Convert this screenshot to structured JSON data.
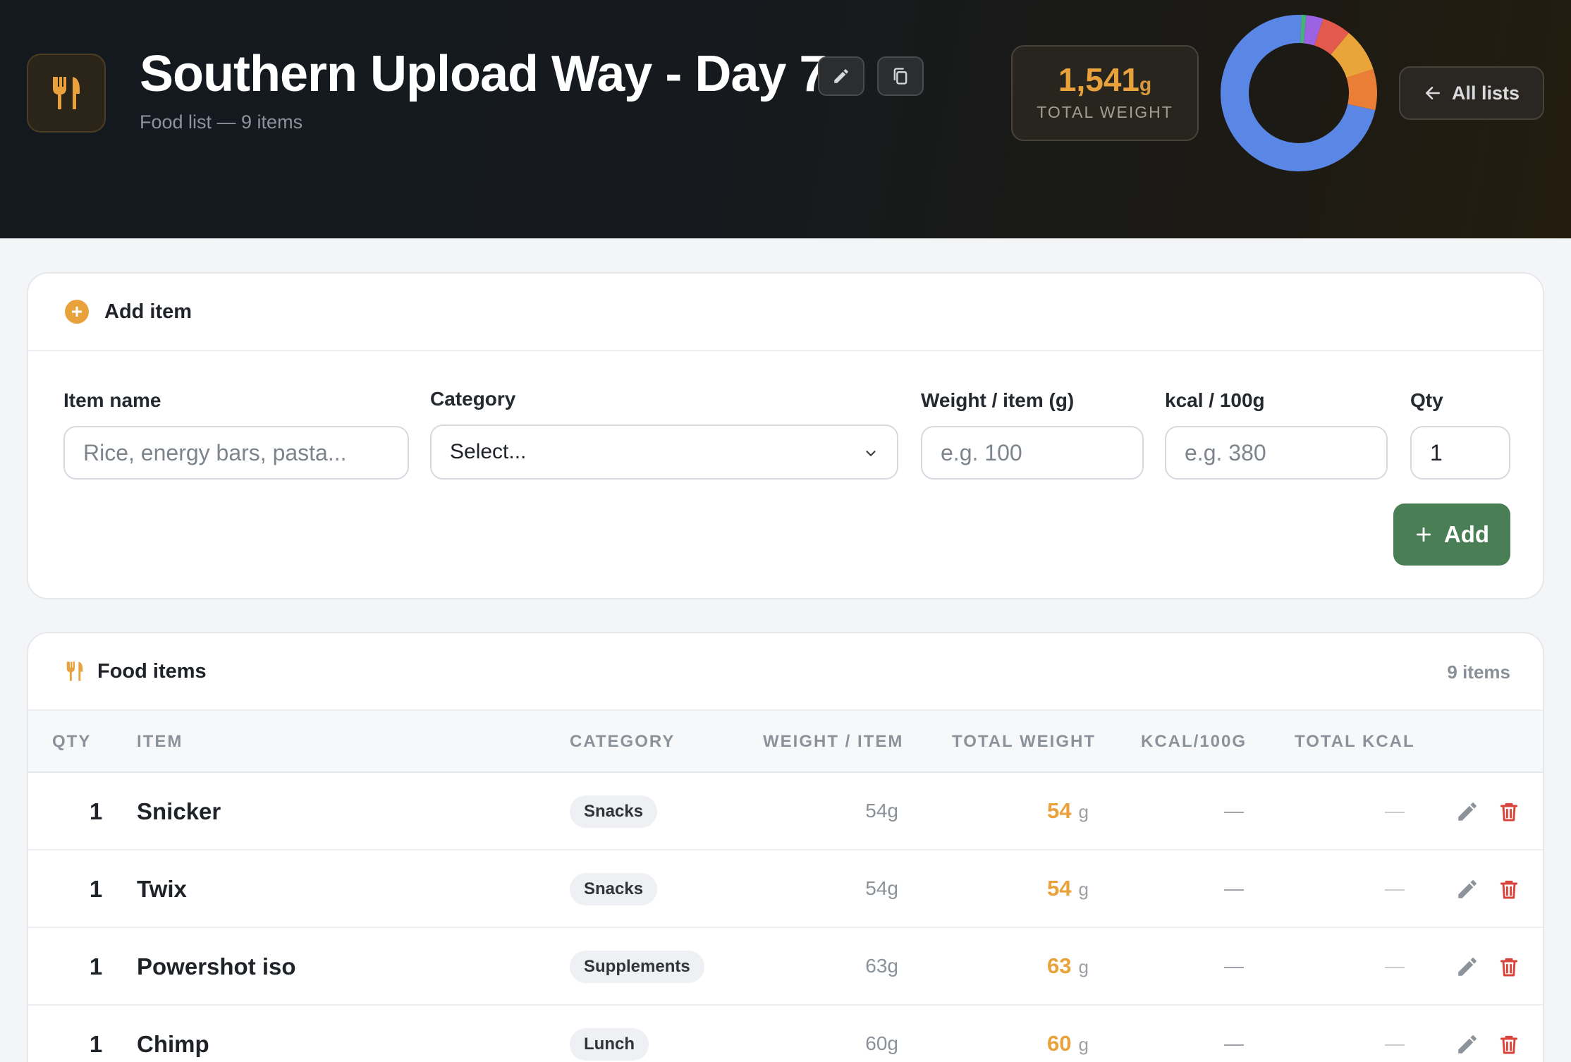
{
  "header": {
    "title": "Southern Upload Way - Day 7",
    "subtitle": "Food list — 9 items",
    "total_weight_value": "1,541",
    "total_weight_unit": "g",
    "total_weight_label": "TOTAL WEIGHT",
    "all_lists_label": "All lists",
    "donut_segments": [
      {
        "fraction": 0.72,
        "color": "#5a86e6"
      },
      {
        "fraction": 0.01,
        "color": "#46b37a"
      },
      {
        "fraction": 0.035,
        "color": "#9b63e2"
      },
      {
        "fraction": 0.06,
        "color": "#e35a4c"
      },
      {
        "fraction": 0.09,
        "color": "#eaa53a"
      },
      {
        "fraction": 0.085,
        "color": "#eb7e37"
      }
    ]
  },
  "add_item": {
    "heading": "Add item",
    "labels": {
      "item_name": "Item name",
      "category": "Category",
      "weight": "Weight / item (g)",
      "kcal": "kcal / 100g",
      "qty": "Qty"
    },
    "placeholders": {
      "item_name": "Rice, energy bars, pasta...",
      "weight": "e.g. 100",
      "kcal": "e.g. 380"
    },
    "category_value": "Select...",
    "qty_value": "1",
    "add_button": "Add"
  },
  "food_items": {
    "heading": "Food items",
    "count": "9 items",
    "columns": {
      "qty": "QTY",
      "item": "ITEM",
      "category": "CATEGORY",
      "weight_item": "WEIGHT / ITEM",
      "total_weight": "TOTAL WEIGHT",
      "kcal100": "KCAL/100G",
      "total_kcal": "TOTAL KCAL"
    },
    "rows": [
      {
        "qty": "1",
        "name": "Snicker",
        "category": "Snacks",
        "weight_item": "54g",
        "total_weight": "54",
        "unit": "g",
        "kcal100": "—",
        "total_kcal": "—"
      },
      {
        "qty": "1",
        "name": "Twix",
        "category": "Snacks",
        "weight_item": "54g",
        "total_weight": "54",
        "unit": "g",
        "kcal100": "—",
        "total_kcal": "—"
      },
      {
        "qty": "1",
        "name": "Powershot iso",
        "category": "Supplements",
        "weight_item": "63g",
        "total_weight": "63",
        "unit": "g",
        "kcal100": "—",
        "total_kcal": "—"
      },
      {
        "qty": "1",
        "name": "Chimp",
        "category": "Lunch",
        "weight_item": "60g",
        "total_weight": "60",
        "unit": "g",
        "kcal100": "—",
        "total_kcal": "—"
      }
    ]
  }
}
